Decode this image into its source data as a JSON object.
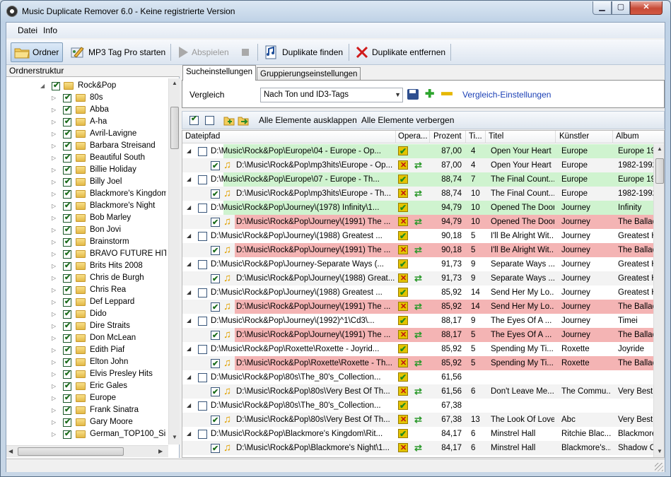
{
  "window": {
    "title": "Music Duplicate Remover 6.0 - Keine registrierte Version",
    "min_label": "▁",
    "max_label": "▢",
    "close_label": "✕"
  },
  "menu": {
    "datei": "Datei",
    "info": "Info"
  },
  "toolbar": {
    "ordner": "Ordner",
    "mp3tag": "MP3 Tag Pro starten",
    "abspielen": "Abspielen",
    "duplikate_finden": "Duplikate finden",
    "duplikate_entfernen": "Duplikate entfernen"
  },
  "tree": {
    "header": "Ordnerstruktur",
    "root": {
      "label": "Rock&Pop",
      "checked": true
    },
    "items": [
      {
        "label": "80s"
      },
      {
        "label": "Abba"
      },
      {
        "label": "A-ha"
      },
      {
        "label": "Avril-Lavigne"
      },
      {
        "label": "Barbara Streisand"
      },
      {
        "label": "Beautiful South"
      },
      {
        "label": "Billie Holiday"
      },
      {
        "label": "Billy Joel"
      },
      {
        "label": "Blackmore's Kingdom"
      },
      {
        "label": "Blackmore's Night"
      },
      {
        "label": "Bob Marley"
      },
      {
        "label": "Bon Jovi"
      },
      {
        "label": "Brainstorm"
      },
      {
        "label": "BRAVO FUTURE HIT"
      },
      {
        "label": "Brits Hits 2008"
      },
      {
        "label": "Chris de Burgh"
      },
      {
        "label": "Chris Rea"
      },
      {
        "label": "Def Leppard"
      },
      {
        "label": "Dido"
      },
      {
        "label": "Dire Straits"
      },
      {
        "label": "Don McLean"
      },
      {
        "label": "Edith Piaf"
      },
      {
        "label": "Elton John"
      },
      {
        "label": "Elvis Presley Hits"
      },
      {
        "label": "Eric Gales"
      },
      {
        "label": "Europe"
      },
      {
        "label": "Frank Sinatra"
      },
      {
        "label": "Gary Moore"
      },
      {
        "label": "German_TOP100_Sin"
      }
    ]
  },
  "tabs": {
    "search": "Sucheinstellungen",
    "group": "Gruppierungseinstellungen"
  },
  "settings": {
    "vergleich_label": "Vergleich",
    "compare_value": "Nach Ton und ID3-Tags",
    "settings_link": "Vergleich-Einstellungen"
  },
  "list_toolbar": {
    "expand_all": "Alle Elemente ausklappen",
    "collapse_all": "Alle Elemente verbergen"
  },
  "grid": {
    "columns": {
      "path": "Dateipfad",
      "op": "Opera...",
      "percent": "Prozent",
      "track": "Ti...",
      "title": "Titel",
      "artist": "Künstler",
      "album": "Album"
    },
    "rows": [
      {
        "type": "parent",
        "color": "green",
        "path": "D:\\Music\\Rock&Pop\\Europe\\04 - Europe - Op...",
        "op": "keep",
        "percent": "87,00",
        "track": "4",
        "title": "Open Your Heart",
        "artist": "Europe",
        "album": "Europe 198"
      },
      {
        "type": "child",
        "color": "",
        "path": "D:\\Music\\Rock&Pop\\mp3hits\\Europe - Op...",
        "op": "delete",
        "percent": "87,00",
        "track": "4",
        "title": "Open Your Heart",
        "artist": "Europe",
        "album": "1982-1992"
      },
      {
        "type": "parent",
        "color": "green",
        "path": "D:\\Music\\Rock&Pop\\Europe\\07 - Europe - Th...",
        "op": "keep",
        "percent": "88,74",
        "track": "7",
        "title": "The Final Count...",
        "artist": "Europe",
        "album": "Europe 198"
      },
      {
        "type": "child",
        "color": "",
        "path": "D:\\Music\\Rock&Pop\\mp3hits\\Europe - Th...",
        "op": "delete",
        "percent": "88,74",
        "track": "10",
        "title": "The Final Count...",
        "artist": "Europe",
        "album": "1982-1992"
      },
      {
        "type": "parent",
        "color": "green",
        "path": "D:\\Music\\Rock&Pop\\Journey\\(1978) Infinity\\1...",
        "op": "keep",
        "percent": "94,79",
        "track": "10",
        "title": "Opened The Door",
        "artist": "Journey",
        "album": "Infinity"
      },
      {
        "type": "child",
        "color": "red",
        "path": "D:\\Music\\Rock&Pop\\Journey\\(1991) The ...",
        "op": "delete",
        "percent": "94,79",
        "track": "10",
        "title": "Opened The Door",
        "artist": "Journey",
        "album": "The Ballad"
      },
      {
        "type": "parent",
        "color": "",
        "path": "D:\\Music\\Rock&Pop\\Journey\\(1988) Greatest ...",
        "op": "keep",
        "percent": "90,18",
        "track": "5",
        "title": "I'll Be Alright Wit...",
        "artist": "Journey",
        "album": "Greatest Hi"
      },
      {
        "type": "child",
        "color": "red",
        "path": "D:\\Music\\Rock&Pop\\Journey\\(1991) The ...",
        "op": "delete",
        "percent": "90,18",
        "track": "5",
        "title": "I'll Be Alright Wit...",
        "artist": "Journey",
        "album": "The Ballad"
      },
      {
        "type": "parent",
        "color": "",
        "path": "D:\\Music\\Rock&Pop\\Journey-Separate Ways (...",
        "op": "keep",
        "percent": "91,73",
        "track": "9",
        "title": "Separate Ways ...",
        "artist": "Journey",
        "album": "Greatest Hi"
      },
      {
        "type": "child",
        "color": "",
        "path": "D:\\Music\\Rock&Pop\\Journey\\(1988) Great...",
        "op": "delete",
        "percent": "91,73",
        "track": "9",
        "title": "Separate Ways ...",
        "artist": "Journey",
        "album": "Greatest Hi"
      },
      {
        "type": "parent",
        "color": "",
        "path": "D:\\Music\\Rock&Pop\\Journey\\(1988) Greatest ...",
        "op": "keep",
        "percent": "85,92",
        "track": "14",
        "title": "Send Her My Lo...",
        "artist": "Journey",
        "album": "Greatest Hi"
      },
      {
        "type": "child",
        "color": "red",
        "path": "D:\\Music\\Rock&Pop\\Journey\\(1991) The ...",
        "op": "delete",
        "percent": "85,92",
        "track": "14",
        "title": "Send Her My Lo...",
        "artist": "Journey",
        "album": "The Ballad"
      },
      {
        "type": "parent",
        "color": "",
        "path": "D:\\Music\\Rock&Pop\\Journey\\(1992)^1\\Cd3\\...",
        "op": "keep",
        "percent": "88,17",
        "track": "9",
        "title": "The Eyes Of A ...",
        "artist": "Journey",
        "album": "Timei"
      },
      {
        "type": "child",
        "color": "red",
        "path": "D:\\Music\\Rock&Pop\\Journey\\(1991) The ...",
        "op": "delete",
        "percent": "88,17",
        "track": "5",
        "title": "The Eyes Of A ...",
        "artist": "Journey",
        "album": "The Ballad"
      },
      {
        "type": "parent",
        "color": "",
        "path": "D:\\Music\\Rock&Pop\\Roxette\\Roxette - Joyrid...",
        "op": "keep",
        "percent": "85,92",
        "track": "5",
        "title": "Spending My Ti...",
        "artist": "Roxette",
        "album": "Joyride"
      },
      {
        "type": "child",
        "color": "red",
        "path": "D:\\Music\\Rock&Pop\\Roxette\\Roxette - Th...",
        "op": "delete",
        "percent": "85,92",
        "track": "5",
        "title": "Spending My Ti...",
        "artist": "Roxette",
        "album": "The Ballad"
      },
      {
        "type": "parent",
        "color": "",
        "path": "D:\\Music\\Rock&Pop\\80s\\The_80's_Collection...",
        "op": "keep",
        "percent": "61,56",
        "track": "",
        "title": "",
        "artist": "",
        "album": ""
      },
      {
        "type": "child",
        "color": "",
        "path": "D:\\Music\\Rock&Pop\\80s\\Very Best Of Th...",
        "op": "delete",
        "percent": "61,56",
        "track": "6",
        "title": "Don't Leave Me...",
        "artist": "The Commu...",
        "album": "Very Best C"
      },
      {
        "type": "parent",
        "color": "",
        "path": "D:\\Music\\Rock&Pop\\80s\\The_80's_Collection...",
        "op": "keep",
        "percent": "67,38",
        "track": "",
        "title": "",
        "artist": "",
        "album": ""
      },
      {
        "type": "child",
        "color": "",
        "path": "D:\\Music\\Rock&Pop\\80s\\Very Best Of Th...",
        "op": "delete",
        "percent": "67,38",
        "track": "13",
        "title": "The Look Of Love",
        "artist": "Abc",
        "album": "Very Best C"
      },
      {
        "type": "parent",
        "color": "",
        "path": "D:\\Music\\Rock&Pop\\Blackmore's Kingdom\\Rit...",
        "op": "keep",
        "percent": "84,17",
        "track": "6",
        "title": "Minstrel Hall",
        "artist": "Ritchie Blac...",
        "album": "Blackmore's"
      },
      {
        "type": "child",
        "color": "",
        "path": "D:\\Music\\Rock&Pop\\Blackmore's Night\\1...",
        "op": "delete",
        "percent": "84,17",
        "track": "6",
        "title": "Minstrel Hall",
        "artist": "Blackmore's...",
        "album": "Shadow Of"
      }
    ]
  },
  "scroll": {
    "up": "▲",
    "down": "▼",
    "left": "◀",
    "right": "▶"
  }
}
